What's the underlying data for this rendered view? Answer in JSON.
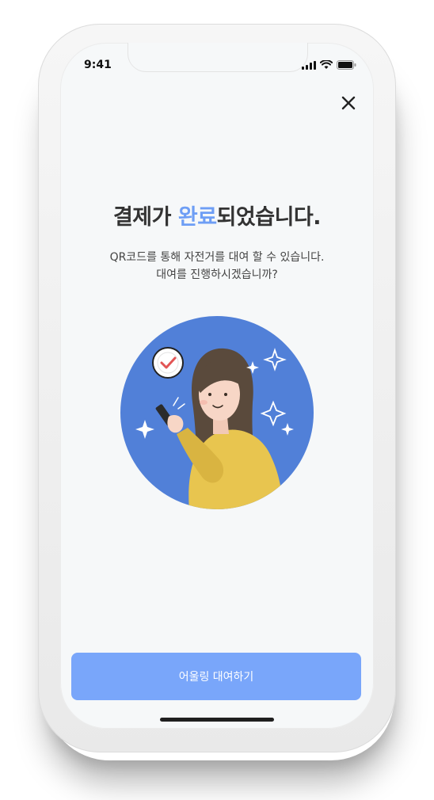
{
  "status_bar": {
    "time": "9:41"
  },
  "header": {
    "close_icon": "close-icon"
  },
  "main": {
    "title_prefix": "결제가 ",
    "title_accent": "완료",
    "title_suffix": "되었습니다.",
    "subtitle_line1": "QR코드를 통해 자전거를 대여 할 수 있습니다.",
    "subtitle_line2": "대여를 진행하시겠습니까?"
  },
  "illustration": {
    "icon": "woman-with-phone-illustration",
    "check_icon": "check-badge-icon"
  },
  "footer": {
    "cta_label": "어울링 대여하기"
  },
  "colors": {
    "accent": "#6e9ef5",
    "cta_bg": "#79a6fa",
    "circle_bg": "#5180d8",
    "sweater": "#e8c54f"
  }
}
